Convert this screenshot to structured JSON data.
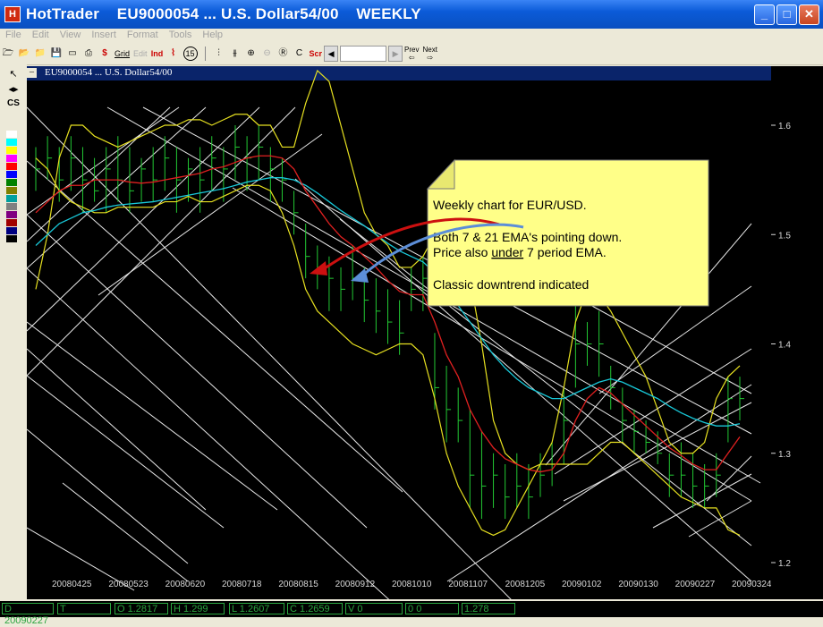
{
  "window": {
    "app_name": "HotTrader",
    "symbol_title": "EU9000054 ... U.S. Dollar54/00",
    "period": "WEEKLY",
    "app_icon": "H"
  },
  "menu": [
    "File",
    "Edit",
    "View",
    "Insert",
    "Format",
    "Tools",
    "Help"
  ],
  "toolbar": {
    "labels": {
      "dollar": "$",
      "grid": "Grid",
      "ind": "Ind",
      "fifteen": "15",
      "c": "C",
      "scr": "Scr",
      "prev": "Prev",
      "next": "Next",
      "edit": "Edit"
    }
  },
  "leftpanel": {
    "cs": "CS"
  },
  "swatches": [
    "#ffffff",
    "#00ffff",
    "#ffff00",
    "#ff00ff",
    "#ff0000",
    "#0000ff",
    "#008000",
    "#808000",
    "#00a0a0",
    "#808080",
    "#800080",
    "#a00000",
    "#000080",
    "#000000"
  ],
  "chart": {
    "title": "EU9000054 ... U.S. Dollar54/00"
  },
  "annotation": {
    "line1": "Weekly chart for EUR/USD.",
    "line2": "Both 7 & 21 EMA's pointing down.",
    "line3_pre": "Price also ",
    "line3_u": "under",
    "line3_post": " 7 period EMA.",
    "line4": "Classic downtrend indicated"
  },
  "status": {
    "date": "20090227",
    "t": "",
    "o": "1.2817",
    "h": "1.299",
    "l": "1.2607",
    "c": "1.2659",
    "v": "0",
    "oi": "0",
    "extra": "1.278"
  },
  "status_labels": {
    "d": "D",
    "t": "T",
    "o": "O",
    "h": "H",
    "l": "L",
    "c": "C",
    "v": "V",
    "oi": "0"
  },
  "chart_data": {
    "type": "bar",
    "ylim": [
      1.2,
      1.62
    ],
    "yticks": [
      1.2,
      1.3,
      1.4,
      1.5,
      1.6
    ],
    "ytick_labels": [
      "1.2",
      "1.3",
      "1.4",
      "1.5",
      "1.6"
    ],
    "xtick_labels": [
      "20080425",
      "20080523",
      "20080620",
      "20080718",
      "20080815",
      "20080912",
      "20081010",
      "20081107",
      "20081205",
      "20090102",
      "20090130",
      "20090227",
      "20090324"
    ],
    "bars": [
      [
        1.58,
        1.54,
        1.56
      ],
      [
        1.59,
        1.55,
        1.57
      ],
      [
        1.58,
        1.53,
        1.55
      ],
      [
        1.59,
        1.54,
        1.57
      ],
      [
        1.58,
        1.52,
        1.55
      ],
      [
        1.57,
        1.53,
        1.54
      ],
      [
        1.58,
        1.52,
        1.56
      ],
      [
        1.59,
        1.53,
        1.55
      ],
      [
        1.58,
        1.52,
        1.54
      ],
      [
        1.57,
        1.53,
        1.56
      ],
      [
        1.58,
        1.53,
        1.55
      ],
      [
        1.59,
        1.54,
        1.57
      ],
      [
        1.58,
        1.52,
        1.55
      ],
      [
        1.57,
        1.53,
        1.56
      ],
      [
        1.58,
        1.52,
        1.55
      ],
      [
        1.59,
        1.54,
        1.57
      ],
      [
        1.58,
        1.53,
        1.56
      ],
      [
        1.6,
        1.55,
        1.58
      ],
      [
        1.59,
        1.54,
        1.57
      ],
      [
        1.6,
        1.55,
        1.58
      ],
      [
        1.58,
        1.53,
        1.56
      ],
      [
        1.57,
        1.53,
        1.55
      ],
      [
        1.54,
        1.5,
        1.52
      ],
      [
        1.51,
        1.46,
        1.48
      ],
      [
        1.49,
        1.45,
        1.47
      ],
      [
        1.48,
        1.43,
        1.46
      ],
      [
        1.47,
        1.43,
        1.45
      ],
      [
        1.49,
        1.44,
        1.46
      ],
      [
        1.47,
        1.42,
        1.44
      ],
      [
        1.46,
        1.41,
        1.43
      ],
      [
        1.45,
        1.4,
        1.42
      ],
      [
        1.44,
        1.39,
        1.41
      ],
      [
        1.47,
        1.43,
        1.45
      ],
      [
        1.48,
        1.43,
        1.46
      ],
      [
        1.41,
        1.34,
        1.36
      ],
      [
        1.38,
        1.31,
        1.34
      ],
      [
        1.36,
        1.31,
        1.33
      ],
      [
        1.34,
        1.25,
        1.28
      ],
      [
        1.32,
        1.24,
        1.27
      ],
      [
        1.3,
        1.25,
        1.28
      ],
      [
        1.29,
        1.24,
        1.26
      ],
      [
        1.3,
        1.25,
        1.27
      ],
      [
        1.29,
        1.24,
        1.26
      ],
      [
        1.3,
        1.26,
        1.28
      ],
      [
        1.31,
        1.27,
        1.29
      ],
      [
        1.36,
        1.29,
        1.33
      ],
      [
        1.47,
        1.36,
        1.4
      ],
      [
        1.42,
        1.38,
        1.4
      ],
      [
        1.43,
        1.37,
        1.4
      ],
      [
        1.38,
        1.34,
        1.36
      ],
      [
        1.36,
        1.31,
        1.33
      ],
      [
        1.34,
        1.3,
        1.32
      ],
      [
        1.33,
        1.3,
        1.31
      ],
      [
        1.32,
        1.29,
        1.3
      ],
      [
        1.3,
        1.26,
        1.28
      ],
      [
        1.31,
        1.26,
        1.28
      ],
      [
        1.3,
        1.25,
        1.27
      ],
      [
        1.29,
        1.25,
        1.27
      ],
      [
        1.3,
        1.26,
        1.28
      ],
      [
        1.37,
        1.31,
        1.35
      ],
      [
        1.37,
        1.33,
        1.35
      ]
    ],
    "ema7": [
      1.52,
      1.53,
      1.54,
      1.545,
      1.545,
      1.55,
      1.55,
      1.55,
      1.548,
      1.547,
      1.548,
      1.55,
      1.552,
      1.554,
      1.556,
      1.56,
      1.562,
      1.566,
      1.57,
      1.572,
      1.572,
      1.57,
      1.56,
      1.54,
      1.525,
      1.51,
      1.498,
      1.49,
      1.48,
      1.47,
      1.458,
      1.448,
      1.445,
      1.445,
      1.42,
      1.39,
      1.37,
      1.34,
      1.32,
      1.305,
      1.295,
      1.29,
      1.285,
      1.283,
      1.285,
      1.3,
      1.33,
      1.35,
      1.36,
      1.355,
      1.345,
      1.335,
      1.325,
      1.315,
      1.305,
      1.298,
      1.29,
      1.285,
      1.285,
      1.3,
      1.315
    ],
    "ema21": [
      1.49,
      1.5,
      1.51,
      1.515,
      1.52,
      1.522,
      1.525,
      1.527,
      1.528,
      1.529,
      1.53,
      1.532,
      1.534,
      1.536,
      1.538,
      1.54,
      1.542,
      1.545,
      1.548,
      1.55,
      1.552,
      1.552,
      1.55,
      1.545,
      1.538,
      1.53,
      1.522,
      1.515,
      1.508,
      1.5,
      1.492,
      1.485,
      1.48,
      1.475,
      1.465,
      1.45,
      1.435,
      1.42,
      1.405,
      1.39,
      1.378,
      1.368,
      1.36,
      1.355,
      1.35,
      1.35,
      1.355,
      1.36,
      1.365,
      1.368,
      1.365,
      1.36,
      1.355,
      1.35,
      1.343,
      1.337,
      1.332,
      1.328,
      1.325,
      1.325,
      1.327
    ],
    "bb_upper": [
      1.45,
      1.5,
      1.57,
      1.6,
      1.6,
      1.59,
      1.585,
      1.58,
      1.585,
      1.59,
      1.595,
      1.6,
      1.6,
      1.605,
      1.605,
      1.6,
      1.605,
      1.61,
      1.61,
      1.6,
      1.6,
      1.58,
      1.58,
      1.62,
      1.65,
      1.64,
      1.6,
      1.56,
      1.52,
      1.5,
      1.49,
      1.47,
      1.47,
      1.48,
      1.5,
      1.52,
      1.5,
      1.46,
      1.4,
      1.33,
      1.3,
      1.29,
      1.285,
      1.29,
      1.31,
      1.36,
      1.42,
      1.45,
      1.445,
      1.43,
      1.41,
      1.39,
      1.37,
      1.34,
      1.31,
      1.3,
      1.3,
      1.31,
      1.35,
      1.37,
      1.38
    ],
    "bb_lower": [
      1.57,
      1.56,
      1.54,
      1.53,
      1.525,
      1.52,
      1.52,
      1.525,
      1.525,
      1.525,
      1.525,
      1.53,
      1.53,
      1.535,
      1.53,
      1.53,
      1.535,
      1.54,
      1.545,
      1.545,
      1.54,
      1.52,
      1.49,
      1.45,
      1.43,
      1.42,
      1.41,
      1.4,
      1.395,
      1.39,
      1.395,
      1.4,
      1.4,
      1.39,
      1.35,
      1.3,
      1.27,
      1.25,
      1.23,
      1.225,
      1.23,
      1.25,
      1.27,
      1.29,
      1.29,
      1.29,
      1.29,
      1.29,
      1.3,
      1.31,
      1.31,
      1.3,
      1.29,
      1.28,
      1.27,
      1.26,
      1.255,
      1.25,
      1.25,
      1.23,
      1.225
    ]
  }
}
